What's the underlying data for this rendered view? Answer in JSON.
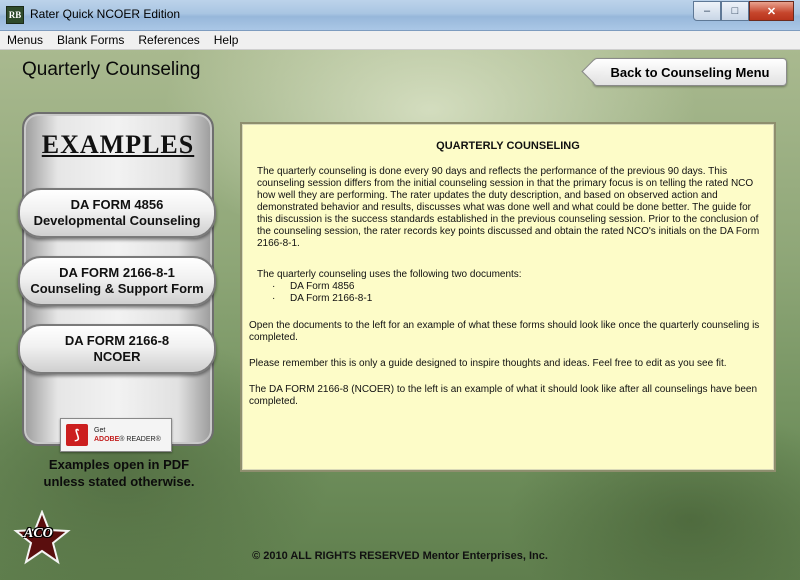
{
  "window": {
    "title": "Rater Quick NCOER Edition",
    "icon_label": "RB",
    "controls": {
      "minimize": "‒",
      "maximize": "□",
      "close": "✕"
    }
  },
  "menu": [
    "Menus",
    "Blank Forms",
    "References",
    "Help"
  ],
  "header": {
    "title": "Quarterly Counseling",
    "back_button": "Back to Counseling Menu"
  },
  "examples": {
    "title": "EXAMPLES",
    "buttons": [
      {
        "line1": "DA FORM 4856",
        "line2": "Developmental Counseling"
      },
      {
        "line1": "DA FORM 2166-8-1",
        "line2": "Counseling & Support Form"
      },
      {
        "line1": "DA FORM 2166-8",
        "line2": "NCOER"
      }
    ],
    "adobe": {
      "get": "Get",
      "brand": "ADOBE",
      "product": "READER"
    },
    "note_line1": "Examples open in PDF",
    "note_line2": "unless stated otherwise."
  },
  "content": {
    "title": "QUARTERLY COUNSELING",
    "paragraph1": "The quarterly counseling is done every 90 days and reflects the performance of the previous 90 days.  This counseling session differs from the initial counseling session in that the primary focus is on telling the rated NCO how well they are performing. The rater updates the duty description, and based on observed action and demonstrated behavior and results, discusses what was done well and what could be done better. The guide for this discussion is the success standards established in the previous counseling session. Prior to the conclusion of the counseling session, the rater records key points discussed and obtain the rated NCO's initials on the DA Form 2166-8-1.",
    "paragraph2": "The quarterly counseling uses the following two documents:",
    "documents": [
      "DA Form 4856",
      "DA Form 2166-8-1"
    ],
    "paragraph3": "Open the documents to the left for an example of what these forms should look like once the quarterly counseling is completed.",
    "paragraph4": "Please remember this is only a guide designed to inspire thoughts and ideas.  Feel free to edit as you see fit.",
    "paragraph5": "The DA FORM 2166-8 (NCOER) to the left is an example of what it should look like after all counselings have been completed."
  },
  "footer": {
    "logo_text": "ACO",
    "copyright": "© 2010 ALL RIGHTS RESERVED Mentor Enterprises, Inc."
  }
}
